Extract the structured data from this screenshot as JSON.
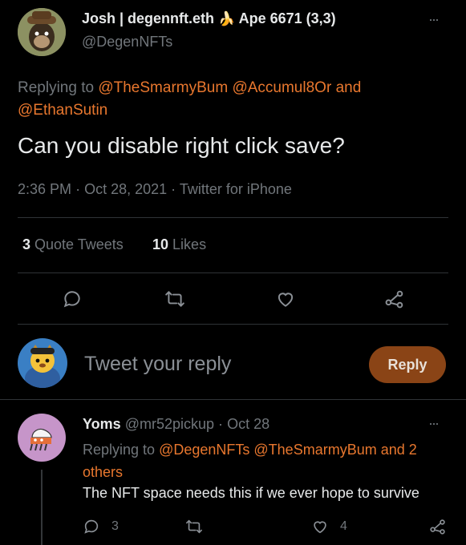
{
  "tweet": {
    "author_name": "Josh | degennft.eth",
    "author_emoji": "🍌",
    "author_suffix": "Ape 6671 (3,3)",
    "author_handle": "@DegenNFTs",
    "replying_to_prefix": "Replying to",
    "replying_to_1": "@TheSmarmyBum",
    "replying_to_2": "@Accumul8Or",
    "replying_to_and": "and",
    "replying_to_3": "@EthanSutin",
    "text": "Can you disable right click save?",
    "time": "2:36 PM",
    "date": "Oct 28, 2021",
    "source": "Twitter for iPhone",
    "sep": "·",
    "quote_count": "3",
    "quote_label": "Quote Tweets",
    "like_count": "10",
    "like_label": "Likes",
    "more": "···"
  },
  "composer": {
    "placeholder": "Tweet your reply",
    "reply_button": "Reply"
  },
  "reply": {
    "author_name": "Yoms",
    "author_handle": "@mr52pickup",
    "sep": "·",
    "date": "Oct 28",
    "replying_to_prefix": "Replying to",
    "replying_to_1": "@DegenNFTs",
    "replying_to_2": "@TheSmarmyBum",
    "replying_to_and": "and 2",
    "replying_to_others": "others",
    "text": "The NFT space needs this if we ever hope to survive",
    "reply_count": "3",
    "like_count": "4",
    "more": "···"
  },
  "colors": {
    "accent": "#e8772e",
    "background": "#000000",
    "muted": "#71767b",
    "reply_button_bg": "#8a4416"
  }
}
